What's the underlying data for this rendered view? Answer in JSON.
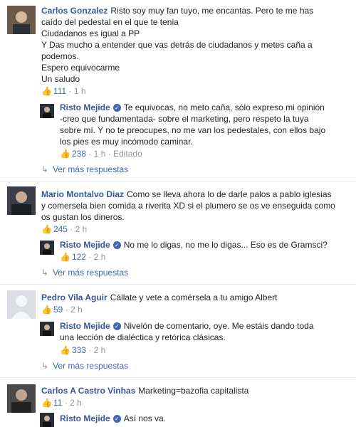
{
  "comments": [
    {
      "author": "Carlos Gonzalez",
      "text": "Risto soy muy fan tuyo, me encantas. Pero te me has caído del pedestal en el que te tenia",
      "extra_lines": [
        "Ciudadanos es igual a PP",
        "Y Das mucho a entender que vas detrás de ciudadanos y metes caña a podemos.",
        "Espero equivocarme",
        "Un saludo"
      ],
      "likes": "111",
      "time": "1 h",
      "reply": {
        "author": "Risto Mejide",
        "text": "Te equivocas, no meto caña, sólo expreso mi opinión -creo que fundamentada- sobre el marketing, pero respeto la tuya sobre mí. Y no te preocupes, no me van los pedestales, con ellos bajo los pies es muy incómodo caminar.",
        "likes": "238",
        "time": "1 h",
        "edited": "Editado"
      },
      "more": "Ver más respuestas"
    },
    {
      "author": "Mario Montalvo Diaz",
      "text": "Como se lleva ahora lo de darle palos a pablo iglesias y comersela bien comida a riverita XD si el plumero se os ve enseguida como os gustan los dineros.",
      "likes": "245",
      "time": "2 h",
      "reply": {
        "author": "Risto Mejide",
        "text": "No me lo digas, no me lo digas... Eso es de Gramsci?",
        "likes": "122",
        "time": "2 h"
      },
      "more": "Ver más respuestas"
    },
    {
      "author": "Pedro Vila Aguir",
      "text": "Cállate y vete a comérsela a tu amigo Albert",
      "likes": "59",
      "time": "2 h",
      "reply": {
        "author": "Risto Mejide",
        "text": "Nivelón de comentario, oye. Me estáis dando toda una lección de dialéctica y retórica clásicas.",
        "likes": "333",
        "time": "2 h"
      },
      "more": "Ver más respuestas"
    },
    {
      "author": "Carlos A Castro Vinhas",
      "text": "Marketing=bazofia capitalista",
      "likes": "11",
      "time": "2 h",
      "reply": {
        "author": "Risto Mejide",
        "text": "Así nos va."
      }
    }
  ],
  "sep": "·",
  "colors": {
    "link": "#365899",
    "meta": "#90949c",
    "accent": "#4267b2"
  }
}
